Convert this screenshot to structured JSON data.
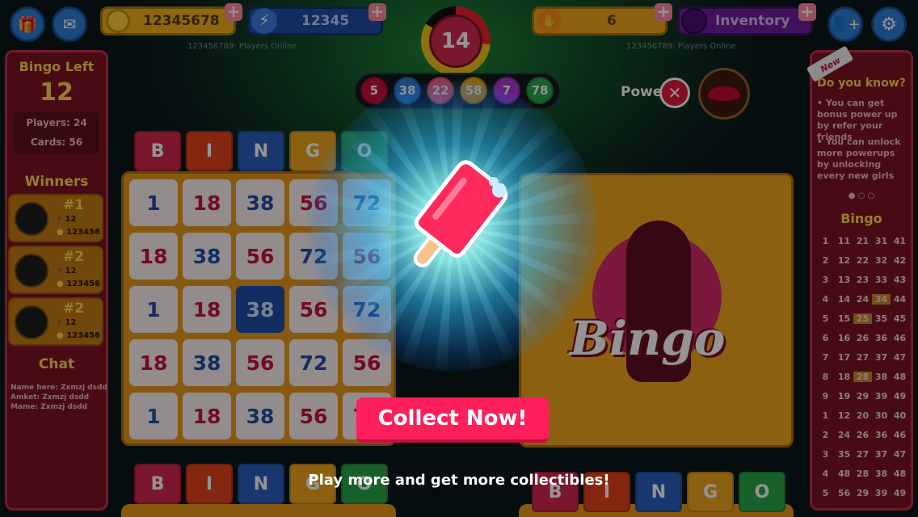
{
  "topbar": {
    "coins": "12345678",
    "energy": "12345",
    "players_online_left": "123456789: Players Online",
    "players_online_right": "123456789: Players Online",
    "timer": "14",
    "powerup_count": "6",
    "inventory_label": "Inventory",
    "plus_glyph": "+",
    "icons": [
      "gift-icon",
      "mail-icon",
      "coin-icon",
      "lightning-icon",
      "hand-icon",
      "orb-icon",
      "add-friend-icon",
      "gear-icon"
    ]
  },
  "called_balls": [
    "5",
    "38",
    "22",
    "58",
    "7",
    "78"
  ],
  "power": {
    "label": "Power",
    "close_glyph": "✕"
  },
  "left_panel": {
    "bingo_left_label": "Bingo Left",
    "bingo_left_value": "12",
    "players": "Players: 24",
    "cards": "Cards: 56",
    "winners_title": "Winners",
    "winners": [
      {
        "rank": "#1",
        "energy": "12",
        "coins": "123456"
      },
      {
        "rank": "#2",
        "energy": "12",
        "coins": "123456"
      },
      {
        "rank": "#2",
        "energy": "12",
        "coins": "123456"
      }
    ],
    "chat_title": "Chat",
    "chat_lines": [
      "Name here: Zxmzj dsdd",
      "Amket: Zxmzj dsdd",
      "Mame: Zxmzj dsdd"
    ]
  },
  "right_panel": {
    "badge": "New",
    "title": "Do you know?",
    "tips": [
      "You can get bonus power up by refer your friends",
      "You can unlock more powerups by unlocking every new girls"
    ],
    "pager": "● ○ ○",
    "bingo_title": "Bingo",
    "mini_rows": [
      [
        "1",
        "11",
        "21",
        "31",
        "41"
      ],
      [
        "2",
        "12",
        "22",
        "32",
        "42"
      ],
      [
        "3",
        "13",
        "23",
        "33",
        "43"
      ],
      [
        "4",
        "14",
        "24",
        "34",
        "44"
      ],
      [
        "5",
        "15",
        "25",
        "35",
        "45"
      ],
      [
        "6",
        "16",
        "26",
        "36",
        "46"
      ],
      [
        "7",
        "17",
        "27",
        "37",
        "47"
      ],
      [
        "8",
        "18",
        "28",
        "38",
        "48"
      ],
      [
        "9",
        "19",
        "29",
        "39",
        "49"
      ],
      [
        "1",
        "12",
        "20",
        "30",
        "40"
      ],
      [
        "2",
        "24",
        "26",
        "36",
        "46"
      ],
      [
        "3",
        "35",
        "27",
        "37",
        "47"
      ],
      [
        "4",
        "48",
        "28",
        "38",
        "48"
      ],
      [
        "5",
        "56",
        "29",
        "39",
        "49"
      ]
    ]
  },
  "card": {
    "headers": [
      "B",
      "I",
      "N",
      "G",
      "O"
    ],
    "rows": [
      [
        "1",
        "18",
        "38",
        "56",
        "72"
      ],
      [
        "18",
        "38",
        "56",
        "72",
        "56"
      ],
      [
        "1",
        "18",
        "38",
        "56",
        "72"
      ],
      [
        "18",
        "38",
        "56",
        "72",
        "56"
      ],
      [
        "1",
        "18",
        "38",
        "56",
        "72"
      ]
    ],
    "bonus_text": "Bingo"
  },
  "modal": {
    "collect_button": "Collect Now!",
    "message": "Play more and get more collectibles!",
    "reward_icon": "popsicle-icon"
  },
  "colors": {
    "accent": "#ff1f5a",
    "panel": "#7d1424",
    "gold": "#f0a81e",
    "blue": "#2f7fd8"
  }
}
